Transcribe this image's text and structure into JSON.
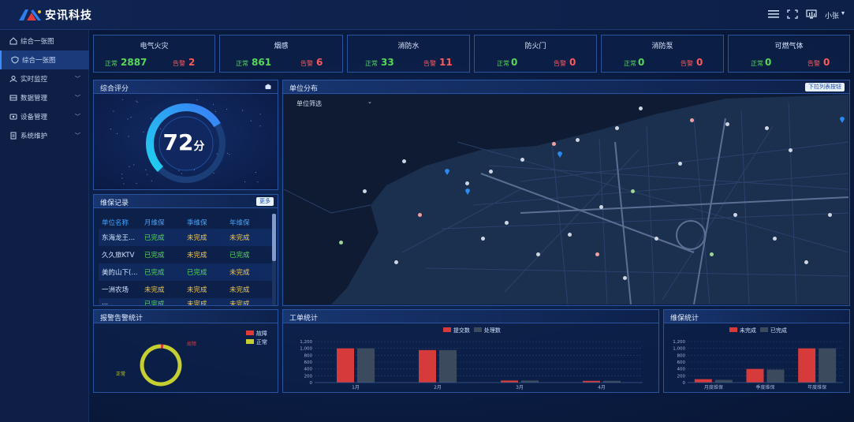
{
  "header": {
    "brand": "安讯科技",
    "user": "小张"
  },
  "sidebar": {
    "items": [
      {
        "label": "综合一张图"
      },
      {
        "label": "综合一张图"
      },
      {
        "label": "实时监控"
      },
      {
        "label": "数据管理"
      },
      {
        "label": "设备管理"
      },
      {
        "label": "系统维护"
      }
    ]
  },
  "stats": [
    {
      "title": "电气火灾",
      "ok_label": "正常",
      "ok": "2887",
      "bad_label": "告警",
      "bad": "2"
    },
    {
      "title": "烟感",
      "ok_label": "正常",
      "ok": "861",
      "bad_label": "告警",
      "bad": "6"
    },
    {
      "title": "消防水",
      "ok_label": "正常",
      "ok": "33",
      "bad_label": "告警",
      "bad": "11"
    },
    {
      "title": "防火门",
      "ok_label": "正常",
      "ok": "0",
      "bad_label": "告警",
      "bad": "0"
    },
    {
      "title": "消防泵",
      "ok_label": "正常",
      "ok": "0",
      "bad_label": "告警",
      "bad": "0"
    },
    {
      "title": "可燃气体",
      "ok_label": "正常",
      "ok": "0",
      "bad_label": "告警",
      "bad": "0"
    }
  ],
  "score_panel": {
    "title": "综合评分",
    "score": "72",
    "unit": "分",
    "score_fraction": 0.72
  },
  "maint_panel": {
    "title": "维保记录",
    "button": "更多",
    "columns": [
      "单位名称",
      "月维保",
      "季维保",
      "年维保"
    ],
    "rows": [
      [
        "东海龙王...",
        "已完成",
        "未完成",
        "未完成"
      ],
      [
        "久久旅KTV",
        "已完成",
        "未完成",
        "已完成"
      ],
      [
        "美的山下(...",
        "已完成",
        "已完成",
        "未完成"
      ],
      [
        "一洲农场",
        "未完成",
        "未完成",
        "未完成"
      ],
      [
        "...",
        "已完成",
        "未完成",
        "未完成"
      ]
    ]
  },
  "map_panel": {
    "title": "单位分布",
    "button": "下拉列表按钮",
    "dropdown": "单位筛选"
  },
  "alarm_panel": {
    "title": "报警告警统计",
    "legend": [
      {
        "label": "故障",
        "color": "#e03a3a"
      },
      {
        "label": "正常",
        "color": "#c6cf32"
      }
    ],
    "ring_labels": [
      "故障",
      "正常"
    ]
  },
  "work_panel": {
    "title": "工单统计",
    "legend": [
      {
        "label": "提交数",
        "color": "#d63a3a"
      },
      {
        "label": "处理数",
        "color": "#3c4a5e"
      }
    ]
  },
  "repair_panel": {
    "title": "维保统计",
    "legend": [
      {
        "label": "未完成",
        "color": "#d63a3a"
      },
      {
        "label": "已完成",
        "color": "#3c4a5e"
      }
    ]
  },
  "chart_data": [
    {
      "type": "bar",
      "categories": [
        "1月",
        "2月",
        "3月",
        "4月"
      ],
      "series": [
        {
          "name": "提交数",
          "values": [
            1000,
            950,
            60,
            50
          ]
        },
        {
          "name": "处理数",
          "values": [
            1000,
            950,
            60,
            50
          ]
        }
      ],
      "yticks": [
        "1,200",
        "1,000",
        "800",
        "600",
        "400",
        "200",
        "0"
      ],
      "ylim": [
        0,
        1200
      ]
    },
    {
      "type": "bar",
      "categories": [
        "月度维保",
        "季度维保",
        "年度维保"
      ],
      "series": [
        {
          "name": "未完成",
          "values": [
            100,
            400,
            1000
          ]
        },
        {
          "name": "已完成",
          "values": [
            80,
            380,
            1000
          ]
        }
      ],
      "yticks": [
        "1,200",
        "1,000",
        "800",
        "600",
        "400",
        "200",
        "0"
      ],
      "ylim": [
        0,
        1200
      ]
    },
    {
      "type": "pie",
      "categories": [
        "故障",
        "正常"
      ],
      "values": [
        2,
        98
      ]
    }
  ]
}
